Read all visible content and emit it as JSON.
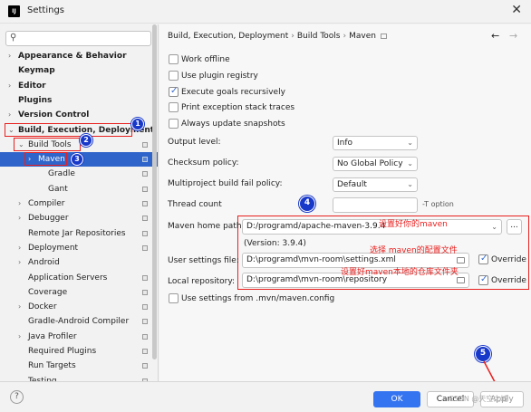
{
  "window": {
    "title": "Settings",
    "app_icon_text": "IJ"
  },
  "sidebar": {
    "search_placeholder": "",
    "items": [
      {
        "label": "Appearance & Behavior",
        "arrow": "›",
        "bold": true
      },
      {
        "label": "Keymap",
        "arrow": "",
        "bold": true
      },
      {
        "label": "Editor",
        "arrow": "›",
        "bold": true
      },
      {
        "label": "Plugins",
        "arrow": "",
        "bold": true
      },
      {
        "label": "Version Control",
        "arrow": "›",
        "bold": true
      },
      {
        "label": "Build, Execution, Deployment",
        "arrow": "⌄",
        "bold": true
      },
      {
        "label": "Build Tools",
        "arrow": "⌄"
      },
      {
        "label": "Maven",
        "arrow": "›",
        "selected": true
      },
      {
        "label": "Gradle",
        "arrow": ""
      },
      {
        "label": "Gant",
        "arrow": ""
      },
      {
        "label": "Compiler",
        "arrow": "›"
      },
      {
        "label": "Debugger",
        "arrow": "›"
      },
      {
        "label": "Remote Jar Repositories",
        "arrow": ""
      },
      {
        "label": "Deployment",
        "arrow": "›"
      },
      {
        "label": "Android",
        "arrow": "›"
      },
      {
        "label": "Application Servers",
        "arrow": ""
      },
      {
        "label": "Coverage",
        "arrow": ""
      },
      {
        "label": "Docker",
        "arrow": "›"
      },
      {
        "label": "Gradle-Android Compiler",
        "arrow": ""
      },
      {
        "label": "Java Profiler",
        "arrow": "›"
      },
      {
        "label": "Required Plugins",
        "arrow": ""
      },
      {
        "label": "Run Targets",
        "arrow": ""
      },
      {
        "label": "Testing",
        "arrow": ""
      }
    ]
  },
  "breadcrumb": {
    "part1": "Build, Execution, Deployment",
    "part2": "Build Tools",
    "part3": "Maven",
    "back": "←",
    "forward": "→"
  },
  "options": {
    "work_offline": "Work offline",
    "use_plugin_registry": "Use plugin registry",
    "execute_goals": "Execute goals recursively",
    "print_exception": "Print exception stack traces",
    "always_update": "Always update snapshots"
  },
  "form": {
    "output_level_label": "Output level:",
    "output_level_value": "Info",
    "checksum_label": "Checksum policy:",
    "checksum_value": "No Global Policy",
    "multiproject_label": "Multiproject build fail policy:",
    "multiproject_value": "Default",
    "thread_count_label": "Thread count",
    "thread_count_value": "",
    "thread_count_hint": "-T option",
    "maven_home_label": "Maven home path:",
    "maven_home_value": "D:/programd/apache-maven-3.9.4",
    "maven_version": "(Version: 3.9.4)",
    "user_settings_label": "User settings file:",
    "user_settings_value": "D:\\programd\\mvn-room\\settings.xml",
    "local_repo_label": "Local repository:",
    "local_repo_value": "D:\\programd\\mvn-room\\repository",
    "override_label": "Override",
    "use_mvn_config": "Use settings from .mvn/maven.config",
    "browse_button": "..."
  },
  "annotations": {
    "maven_home_note": "设置好你的maven",
    "settings_note": "选择 maven的配置文件",
    "repo_note": "设置好maven本地的仓库文件夹",
    "badges": [
      "1",
      "2",
      "3",
      "4",
      "5"
    ]
  },
  "footer": {
    "help": "?",
    "ok": "OK",
    "cancel": "Cancel",
    "apply": "Apply",
    "watermark": "CSDN @天空之城"
  },
  "colors": {
    "selection": "#2f65ca",
    "annotation_red": "#e8201f",
    "badge_blue": "#1838c9",
    "ok_blue": "#3574f0"
  }
}
